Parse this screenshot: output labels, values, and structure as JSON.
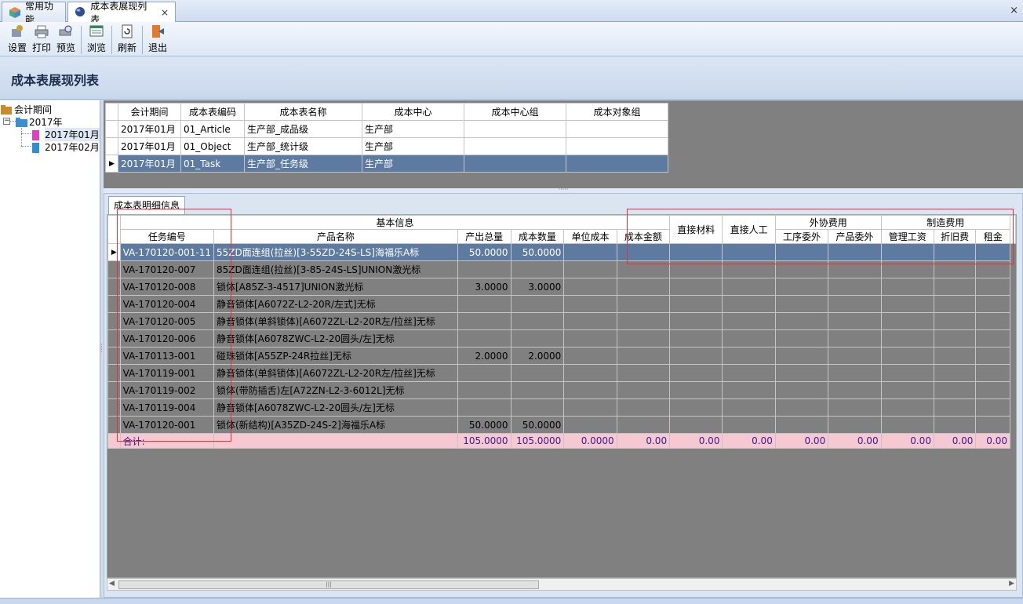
{
  "tabs": [
    {
      "label": "常用功能",
      "icon": "cube-icon"
    },
    {
      "label": "成本表展现列表",
      "icon": "globe-icon",
      "close": "×"
    }
  ],
  "window_close": "×",
  "toolbar": [
    {
      "label": "设置",
      "icon": "settings-icon"
    },
    {
      "label": "打印",
      "icon": "printer-icon"
    },
    {
      "label": "预览",
      "icon": "preview-icon"
    },
    {
      "label": "浏览",
      "icon": "browse-icon"
    },
    {
      "label": "刷新",
      "icon": "refresh-icon"
    },
    {
      "label": "退出",
      "icon": "exit-icon"
    }
  ],
  "page_title": "成本表展现列表",
  "tree": {
    "root": "会计期间",
    "year": "2017年",
    "expander": "−",
    "months": [
      "2017年01月",
      "2017年02月"
    ],
    "selected": "2017年01月"
  },
  "top_grid": {
    "columns": [
      "会计期间",
      "成本表编码",
      "成本表名称",
      "成本中心",
      "成本中心组",
      "成本对象组"
    ],
    "rows": [
      [
        "2017年01月",
        "01_Article",
        "生产部_成品级",
        "生产部",
        "",
        ""
      ],
      [
        "2017年01月",
        "01_Object",
        "生产部_统计级",
        "生产部",
        "",
        ""
      ],
      [
        "2017年01月",
        "01_Task",
        "生产部_任务级",
        "生产部",
        "",
        ""
      ]
    ],
    "selected_row": 2
  },
  "detail": {
    "tab_label": "成本表明细信息",
    "group_headers": {
      "basic": "基本信息",
      "direct_material": "直接材料",
      "direct_labor": "直接人工",
      "outsourcing": "外协费用",
      "manufacturing": "制造费用"
    },
    "columns": [
      "任务编号",
      "产品名称",
      "产出总量",
      "成本数量",
      "单位成本",
      "成本金额",
      "工序委外",
      "产品委外",
      "管理工资",
      "折旧费",
      "租金"
    ],
    "rows": [
      [
        "VA-170120-001-11",
        "55ZD面连组(拉丝)[3-55ZD-24S-LS]海福乐A标",
        "50.0000",
        "50.0000"
      ],
      [
        "VA-170120-007",
        "85ZD面连组(拉丝)[3-85-24S-LS]UNION激光标",
        "",
        ""
      ],
      [
        "VA-170120-008",
        "锁体[A85Z-3-4517]UNION激光标",
        "3.0000",
        "3.0000"
      ],
      [
        "VA-170120-004",
        "静音锁体[A6072Z-L2-20R/左式]无标",
        "",
        ""
      ],
      [
        "VA-170120-005",
        "静音锁体(单斜锁体)[A6072ZL-L2-20R左/拉丝]无标",
        "",
        ""
      ],
      [
        "VA-170120-006",
        "静音锁体[A6078ZWC-L2-20圆头/左]无标",
        "",
        ""
      ],
      [
        "VA-170113-001",
        "碰珠锁体[A55ZP-24R拉丝]无标",
        "2.0000",
        "2.0000"
      ],
      [
        "VA-170119-001",
        "静音锁体(单斜锁体)[A6072ZL-L2-20R左/拉丝]无标",
        "",
        ""
      ],
      [
        "VA-170119-002",
        "锁体(带防插舌)左[A72ZN-L2-3-6012L]无标",
        "",
        ""
      ],
      [
        "VA-170119-004",
        "静音锁体[A6078ZWC-L2-20圆头/左]无标",
        "",
        ""
      ],
      [
        "VA-170120-001",
        "锁体(新结构)[A35ZD-24S-2]海福乐A标",
        "50.0000",
        "50.0000"
      ]
    ],
    "selected_row": 0,
    "total": {
      "label": "合计:",
      "output_total": "105.0000",
      "cost_qty": "105.0000",
      "unit_cost": "0.0000",
      "cost_amount": "0.00",
      "direct_material": "0.00",
      "direct_labor": "0.00",
      "process_outsourcing": "0.00",
      "product_outsourcing": "0.00",
      "mgmt_wage": "0.00",
      "depreciation": "0.00",
      "rent": "0.00"
    }
  },
  "colors": {
    "selected_row": "#5d7aa0",
    "total_row": "#f6c8d2",
    "highlight_box": "#e8303a"
  }
}
